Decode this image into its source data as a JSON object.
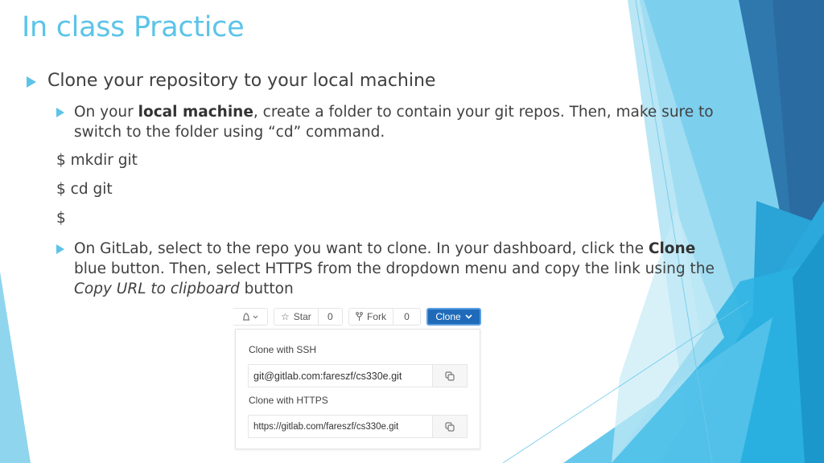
{
  "slide": {
    "title": "In class Practice",
    "bullets": [
      {
        "text": "Clone your repository to your local machine"
      }
    ],
    "sub_bullet_1": {
      "pre": "On your ",
      "bold": "local machine",
      "post": ", create a folder to contain your git repos. Then, make sure to switch to the folder using “cd” command."
    },
    "commands": [
      "$ mkdir git",
      "$ cd git",
      "$"
    ],
    "sub_bullet_2": {
      "pre": "On GitLab, select to the repo you want to clone. In your dashboard, click the ",
      "bold": "Clone",
      "mid": " blue button. Then, select HTTPS from the dropdown menu and copy the link using the ",
      "italic": "Copy URL to clipboard",
      "post": " button"
    }
  },
  "gitlab": {
    "notification_icon": "bell-icon",
    "star_label": "Star",
    "star_count": "0",
    "fork_label": "Fork",
    "fork_count": "0",
    "clone_label": "Clone",
    "ssh_label": "Clone with SSH",
    "ssh_url": "git@gitlab.com:fareszf/cs330e.git",
    "https_label": "Clone with HTTPS",
    "https_url": "https://gitlab.com/fareszf/cs330e.git",
    "copy_icon": "copy-icon"
  },
  "theme": {
    "accent": "#5bc4e8",
    "clone_button": "#1f6bba"
  }
}
